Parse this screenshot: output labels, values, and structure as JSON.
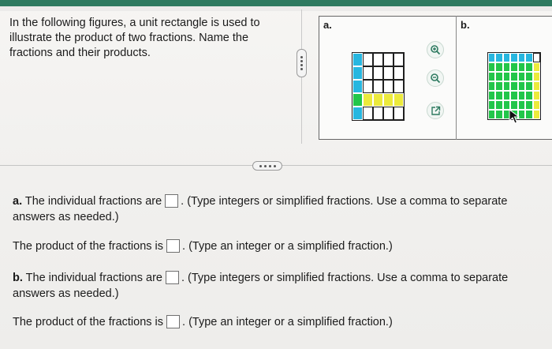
{
  "prompt": "In the following figures, a unit rectangle is used to illustrate the product of two fractions. Name the fractions and their products.",
  "figure": {
    "label_a": "a.",
    "label_b": "b.",
    "grid_a": {
      "rows": 5,
      "cols": 5,
      "colors": {
        "blue": "#27b7e0",
        "green": "#22c64a",
        "yellow": "#ecea3c",
        "blank": "#ffffff"
      },
      "cells": [
        [
          "blue",
          "blank",
          "blank",
          "blank",
          "blank"
        ],
        [
          "blue",
          "blank",
          "blank",
          "blank",
          "blank"
        ],
        [
          "blue",
          "blank",
          "blank",
          "blank",
          "blank"
        ],
        [
          "green",
          "yellow",
          "yellow",
          "yellow",
          "yellow"
        ],
        [
          "blue",
          "blank",
          "blank",
          "blank",
          "blank"
        ]
      ]
    },
    "grid_b": {
      "rows": 7,
      "cols": 7,
      "colors": {
        "blue": "#27b7e0",
        "green": "#22c64a",
        "yellow": "#ecea3c",
        "blank": "#ffffff"
      },
      "cells": [
        [
          "blue",
          "blue",
          "blue",
          "blue",
          "blue",
          "blue",
          "blank"
        ],
        [
          "green",
          "green",
          "green",
          "green",
          "green",
          "green",
          "yellow"
        ],
        [
          "green",
          "green",
          "green",
          "green",
          "green",
          "green",
          "yellow"
        ],
        [
          "green",
          "green",
          "green",
          "green",
          "green",
          "green",
          "yellow"
        ],
        [
          "green",
          "green",
          "green",
          "green",
          "green",
          "green",
          "yellow"
        ],
        [
          "green",
          "green",
          "green",
          "green",
          "green",
          "green",
          "yellow"
        ],
        [
          "green",
          "green",
          "green",
          "green",
          "green",
          "green",
          "yellow"
        ]
      ]
    },
    "tools": [
      "zoom-in-icon",
      "zoom-out-icon",
      "pop-out-icon"
    ]
  },
  "questions": {
    "a_fractions": {
      "prefix": "a.",
      "text_before": "The individual fractions are",
      "text_after": ". (Type integers or simplified fractions. Use a comma to separate",
      "text_line2": "answers as needed.)",
      "value": ""
    },
    "a_product": {
      "text_before": "The product of the fractions is",
      "text_after": ". (Type an integer or a simplified fraction.)",
      "value": ""
    },
    "b_fractions": {
      "prefix": "b.",
      "text_before": "The individual fractions are",
      "text_after": ". (Type integers or simplified fractions. Use a comma to separate",
      "text_line2": "answers as needed.)",
      "value": ""
    },
    "b_product": {
      "text_before": "The product of the fractions is",
      "text_after": ". (Type an integer or a simplified fraction.)",
      "value": ""
    }
  },
  "colors": {
    "header": "#2e7a60",
    "accent_tool": "#2e7a60"
  }
}
